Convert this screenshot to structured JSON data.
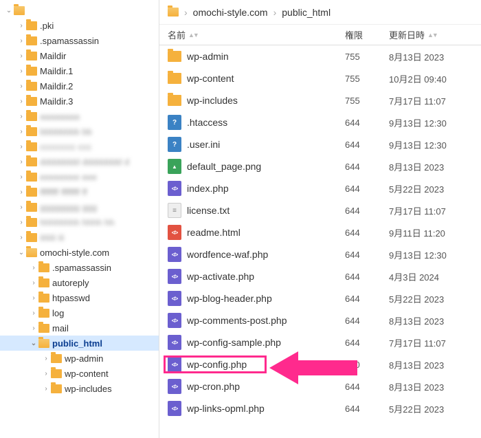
{
  "breadcrumb": {
    "items": [
      "omochi-style.com",
      "public_html"
    ]
  },
  "columns": {
    "name": "名前",
    "perm": "権限",
    "date": "更新日時"
  },
  "tree": [
    {
      "depth": 0,
      "label": "",
      "icon": "folder-open",
      "chev": "down"
    },
    {
      "depth": 1,
      "label": ".pki",
      "icon": "folder",
      "chev": "right"
    },
    {
      "depth": 1,
      "label": ".spamassassin",
      "icon": "folder",
      "chev": "right"
    },
    {
      "depth": 1,
      "label": "Maildir",
      "icon": "folder",
      "chev": "right"
    },
    {
      "depth": 1,
      "label": "Maildir.1",
      "icon": "folder",
      "chev": "right"
    },
    {
      "depth": 1,
      "label": "Maildir.2",
      "icon": "folder",
      "chev": "right"
    },
    {
      "depth": 1,
      "label": "Maildir.3",
      "icon": "folder",
      "chev": "right"
    },
    {
      "depth": 1,
      "label": "aaaaaaaa",
      "icon": "folder",
      "chev": "right",
      "blurred": true
    },
    {
      "depth": 1,
      "label": "bbbbbbbb bb",
      "icon": "folder",
      "chev": "right",
      "blurred": true
    },
    {
      "depth": 1,
      "label": "cccccccc ccc",
      "icon": "folder",
      "chev": "right",
      "blurred": true
    },
    {
      "depth": 1,
      "label": "dddddddd dddddddd d",
      "icon": "folder",
      "chev": "right",
      "blurred": true
    },
    {
      "depth": 1,
      "label": "eeeeeeee eee",
      "icon": "folder",
      "chev": "right",
      "blurred": true
    },
    {
      "depth": 1,
      "label": "ffffffff ffffffff ff",
      "icon": "folder",
      "chev": "right",
      "blurred": true
    },
    {
      "depth": 1,
      "label": "gggggggg ggg",
      "icon": "folder",
      "chev": "right",
      "blurred": true
    },
    {
      "depth": 1,
      "label": "hhhhhhhh hhhh hh",
      "icon": "folder",
      "chev": "right",
      "blurred": true
    },
    {
      "depth": 1,
      "label": "iiiiiiii iii",
      "icon": "folder",
      "chev": "right",
      "blurred": true
    },
    {
      "depth": 1,
      "label": "omochi-style.com",
      "icon": "folder-open",
      "chev": "down"
    },
    {
      "depth": 2,
      "label": ".spamassassin",
      "icon": "folder",
      "chev": "right"
    },
    {
      "depth": 2,
      "label": "autoreply",
      "icon": "folder",
      "chev": "right"
    },
    {
      "depth": 2,
      "label": "htpasswd",
      "icon": "folder",
      "chev": "right"
    },
    {
      "depth": 2,
      "label": "log",
      "icon": "folder",
      "chev": "right"
    },
    {
      "depth": 2,
      "label": "mail",
      "icon": "folder",
      "chev": "right"
    },
    {
      "depth": 2,
      "label": "public_html",
      "icon": "folder-open",
      "chev": "down",
      "selected": true
    },
    {
      "depth": 3,
      "label": "wp-admin",
      "icon": "folder",
      "chev": "right"
    },
    {
      "depth": 3,
      "label": "wp-content",
      "icon": "folder",
      "chev": "right"
    },
    {
      "depth": 3,
      "label": "wp-includes",
      "icon": "folder",
      "chev": "right"
    }
  ],
  "files": [
    {
      "name": "wp-admin",
      "perm": "755",
      "date": "8月13日 2023",
      "icon": "folder"
    },
    {
      "name": "wp-content",
      "perm": "755",
      "date": "10月2日 09:40",
      "icon": "folder"
    },
    {
      "name": "wp-includes",
      "perm": "755",
      "date": "7月17日 11:07",
      "icon": "folder"
    },
    {
      "name": ".htaccess",
      "perm": "644",
      "date": "9月13日 12:30",
      "icon": "ques"
    },
    {
      "name": ".user.ini",
      "perm": "644",
      "date": "9月13日 12:30",
      "icon": "ques"
    },
    {
      "name": "default_page.png",
      "perm": "644",
      "date": "8月13日 2023",
      "icon": "img"
    },
    {
      "name": "index.php",
      "perm": "644",
      "date": "5月22日 2023",
      "icon": "php"
    },
    {
      "name": "license.txt",
      "perm": "644",
      "date": "7月17日 11:07",
      "icon": "txt"
    },
    {
      "name": "readme.html",
      "perm": "644",
      "date": "9月11日 11:20",
      "icon": "code"
    },
    {
      "name": "wordfence-waf.php",
      "perm": "644",
      "date": "9月13日 12:30",
      "icon": "php"
    },
    {
      "name": "wp-activate.php",
      "perm": "644",
      "date": "4月3日 2024",
      "icon": "php"
    },
    {
      "name": "wp-blog-header.php",
      "perm": "644",
      "date": "5月22日 2023",
      "icon": "php"
    },
    {
      "name": "wp-comments-post.php",
      "perm": "644",
      "date": "8月13日 2023",
      "icon": "php"
    },
    {
      "name": "wp-config-sample.php",
      "perm": "644",
      "date": "7月17日 11:07",
      "icon": "php"
    },
    {
      "name": "wp-config.php",
      "perm": "600",
      "date": "8月13日 2023",
      "icon": "php",
      "highlight": true
    },
    {
      "name": "wp-cron.php",
      "perm": "644",
      "date": "8月13日 2023",
      "icon": "php"
    },
    {
      "name": "wp-links-opml.php",
      "perm": "644",
      "date": "5月22日 2023",
      "icon": "php"
    }
  ]
}
